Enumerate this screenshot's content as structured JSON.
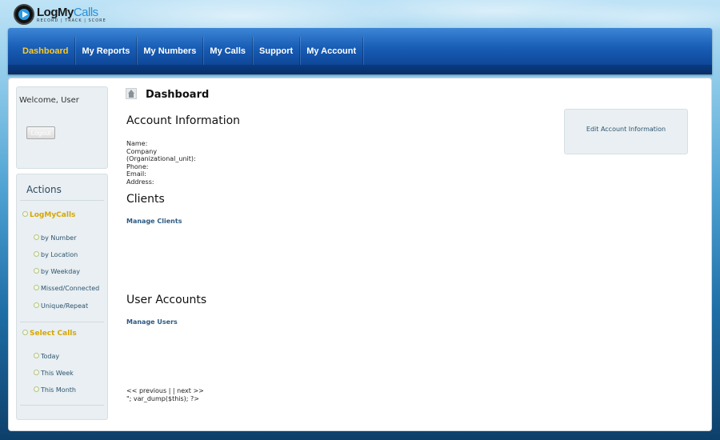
{
  "logo": {
    "main": "LogMy",
    "accent": "Calls",
    "tagline": "RECORD | TRACK | SCORE"
  },
  "nav": {
    "items": [
      {
        "label": "Dashboard",
        "active": true
      },
      {
        "label": "My Reports"
      },
      {
        "label": "My Numbers"
      },
      {
        "label": "My Calls"
      },
      {
        "label": "Support"
      },
      {
        "label": "My Account"
      }
    ]
  },
  "sidebar": {
    "welcome": "Welcome, User",
    "logout_label": "Logout",
    "actions_title": "Actions",
    "groups": [
      {
        "title": "LogMyCalls",
        "items": [
          "by Number",
          "by Location",
          "by Weekday",
          "Missed/Connected",
          "Unique/Repeat"
        ]
      },
      {
        "title": "Select Calls",
        "items": [
          "Today",
          "This Week",
          "This Month"
        ]
      }
    ]
  },
  "main": {
    "page_title": "Dashboard",
    "account_heading": "Account Information",
    "account_fields": [
      "Name:",
      "Company (Organizational_unit):",
      "Phone:",
      "Email:",
      "Address:"
    ],
    "clients_heading": "Clients",
    "manage_clients": "Manage Clients",
    "users_heading": "User Accounts",
    "manage_users": "Manage Users",
    "pager": "<< previous | | next >>",
    "debug": "\"; var_dump($this); ?>",
    "edit_account": "Edit Account Information"
  },
  "colors": {
    "nav_active": "#ffc926",
    "link": "#2d5a82",
    "section_head": "#d6a700"
  }
}
